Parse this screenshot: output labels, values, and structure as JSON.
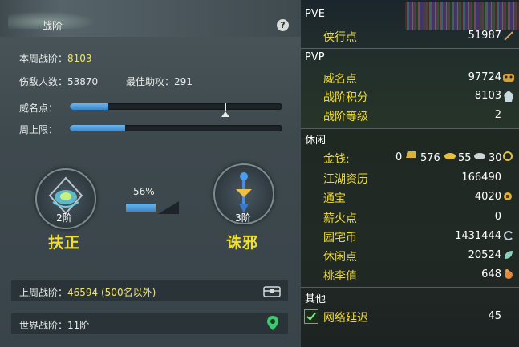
{
  "left": {
    "title": "战阶",
    "help": "?",
    "weekly_label": "本周战阶：",
    "weekly_value": "8103",
    "enemies": "伤敌人数：53870",
    "assists": "最佳助攻：291",
    "prestige_label": "威名点：",
    "prestige_fill": 0.18,
    "weekly_cap_label": "周上限：",
    "weekly_cap_fill": 0.26,
    "left_emblem": {
      "level": "2阶",
      "name": "扶正"
    },
    "right_emblem": {
      "level": "3阶",
      "name": "诛邪"
    },
    "progress_pct": "56%",
    "progress_value": 0.56,
    "last_week_label": "上周战阶：",
    "last_week_value": "46594 (500名以外)",
    "world_label": "世界战阶：11阶"
  },
  "right": {
    "pve": {
      "header": "PVE",
      "items": [
        {
          "label": "侠行点",
          "value": "51987"
        }
      ]
    },
    "pvp": {
      "header": "PVP",
      "items": [
        {
          "label": "威名点",
          "value": "97724"
        },
        {
          "label": "战阶积分",
          "value": "8103"
        },
        {
          "label": "战阶等级",
          "value": "2"
        }
      ]
    },
    "leisure": {
      "header": "休闲",
      "money_label": "金钱:",
      "money": {
        "a": "0",
        "b": "576",
        "c": "55",
        "d": "30"
      },
      "items": [
        {
          "label": "江湖资历",
          "value": "166490"
        },
        {
          "label": "通宝",
          "value": "4020"
        },
        {
          "label": "薪火点",
          "value": "0"
        },
        {
          "label": "园宅币",
          "value": "1431444"
        },
        {
          "label": "休闲点",
          "value": "20524"
        },
        {
          "label": "桃李值",
          "value": "648"
        }
      ]
    },
    "other": {
      "header": "其他",
      "latency_label": "网络延迟",
      "latency_value": "45"
    }
  },
  "colors": {
    "label_yellow": "#f0dc30",
    "accent_blue": "#4a9ee0",
    "title_yellow": "#f0e02a"
  }
}
